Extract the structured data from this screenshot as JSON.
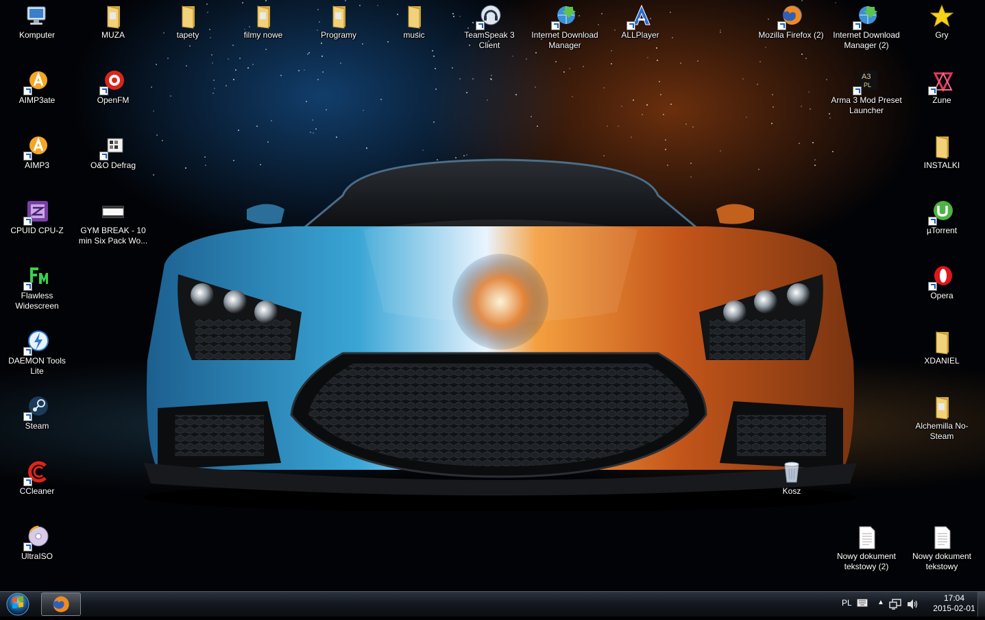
{
  "desktop": {
    "icons": {
      "komputer": {
        "label": "Komputer",
        "icon": "computer-icon"
      },
      "muza": {
        "label": "MUZA",
        "icon": "folder-icon"
      },
      "tapety": {
        "label": "tapety",
        "icon": "folder-icon"
      },
      "filmy": {
        "label": "filmy nowe",
        "icon": "folder-icon"
      },
      "programy": {
        "label": "Programy",
        "icon": "folder-icon"
      },
      "music": {
        "label": "music",
        "icon": "folder-icon"
      },
      "teamspeak": {
        "label": "TeamSpeak 3 Client",
        "icon": "teamspeak-icon"
      },
      "idm": {
        "label": "Internet Download Manager",
        "icon": "idm-icon"
      },
      "allplayer": {
        "label": "ALLPlayer",
        "icon": "allplayer-icon"
      },
      "firefox2": {
        "label": "Mozilla Firefox (2)",
        "icon": "firefox-icon"
      },
      "idm2": {
        "label": "Internet Download Manager (2)",
        "icon": "idm-icon"
      },
      "gry": {
        "label": "Gry",
        "icon": "star-icon"
      },
      "aimp3ate": {
        "label": "AIMP3ate",
        "icon": "aimp-icon"
      },
      "openfm": {
        "label": "OpenFM",
        "icon": "openfm-icon"
      },
      "arma": {
        "label": "Arma 3 Mod Preset Launcher",
        "icon": "arma-icon"
      },
      "zune": {
        "label": "Zune",
        "icon": "zune-icon"
      },
      "aimp3": {
        "label": "AIMP3",
        "icon": "aimp-icon"
      },
      "oodefrag": {
        "label": "O&O Defrag",
        "icon": "defrag-icon"
      },
      "instalki": {
        "label": "INSTALKI",
        "icon": "folder-icon"
      },
      "cpuz": {
        "label": "CPUID CPU-Z",
        "icon": "cpuz-icon"
      },
      "gymbreak": {
        "label": "GYM BREAK - 10 min Six Pack Wo...",
        "icon": "video-file-icon"
      },
      "utorrent": {
        "label": "µTorrent",
        "icon": "utorrent-icon"
      },
      "flawless": {
        "label": "Flawless Widescreen",
        "icon": "flawless-icon"
      },
      "opera": {
        "label": "Opera",
        "icon": "opera-icon"
      },
      "daemon": {
        "label": "DAEMON Tools Lite",
        "icon": "daemon-tools-icon"
      },
      "xdaniel": {
        "label": "XDANIEL",
        "icon": "folder-icon"
      },
      "steam": {
        "label": "Steam",
        "icon": "steam-icon"
      },
      "alchemilla": {
        "label": "Alchemilla No-Steam",
        "icon": "folder-icon"
      },
      "ccleaner": {
        "label": "CCleaner",
        "icon": "ccleaner-icon"
      },
      "kosz": {
        "label": "Kosz",
        "icon": "recycle-bin-icon"
      },
      "ultraiso": {
        "label": "UltraISO",
        "icon": "ultraiso-icon"
      },
      "nowy2": {
        "label": "Nowy dokument tekstowy (2)",
        "icon": "text-document-icon"
      },
      "nowy": {
        "label": "Nowy dokument tekstowy",
        "icon": "text-document-icon"
      }
    }
  },
  "taskbar": {
    "start_icon": "windows-start-icon",
    "pinned": [
      {
        "icon": "firefox-icon",
        "active": true
      }
    ],
    "tray": {
      "language": "PL",
      "time": "17:04",
      "date": "2015-02-01"
    }
  },
  "colors": {
    "folder": "#e8c45a",
    "shortcut_arrow": "#1560c0",
    "taskbar": "#141920"
  }
}
